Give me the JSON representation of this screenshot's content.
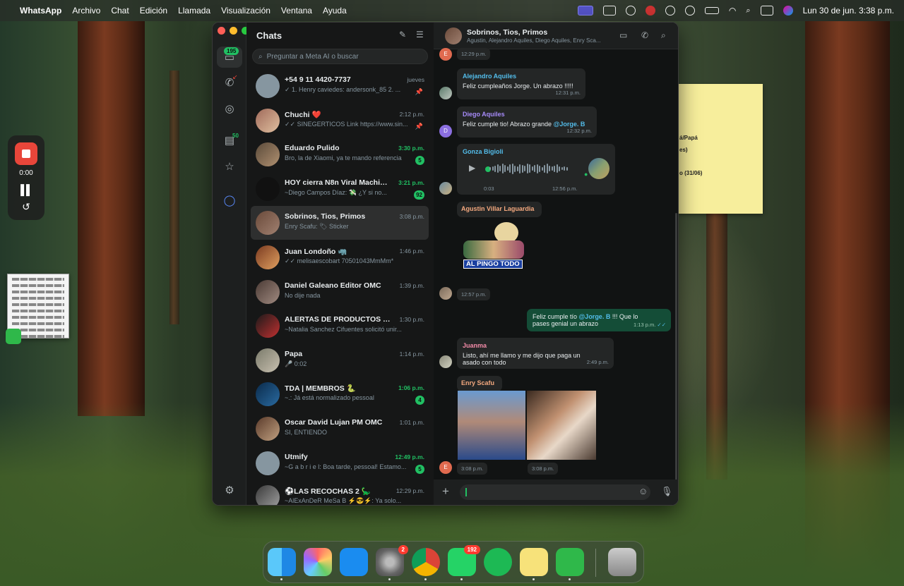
{
  "menubar": {
    "apple": "",
    "items": [
      "WhatsApp",
      "Archivo",
      "Chat",
      "Edición",
      "Llamada",
      "Visualización",
      "Ventana",
      "Ayuda"
    ],
    "clock": "Lun 30 de jun.  3:38 p.m."
  },
  "recorder": {
    "time": "0:00"
  },
  "sticky_note": {
    "lines": [
      "á/Papá",
      "es)",
      "o (31/06)"
    ]
  },
  "rail": {
    "chats_badge": "195",
    "status_badge": "50"
  },
  "list": {
    "title": "Chats",
    "search_placeholder": "Preguntar a Meta AI o buscar",
    "chats": [
      {
        "name": "+54 9 11 4420-7737",
        "time": "jueves",
        "preview": "✓ 1. Henry caviedes:  andersonk_85 2. ...",
        "pinned": true,
        "badge": "",
        "unread": false,
        "selected": false
      },
      {
        "name": "Chuchi ❤️",
        "time": "2:12 p.m.",
        "preview": "✓✓ SINEGERTICOS  Link  https://www.sin...",
        "pinned": true,
        "badge": "",
        "unread": false,
        "selected": false
      },
      {
        "name": "Eduardo Pulido",
        "time": "3:30 p.m.",
        "preview": "Bro, la de Xiaomi, ya te mando referencia",
        "pinned": false,
        "badge": "5",
        "unread": true,
        "selected": false
      },
      {
        "name": "HOY cierra N8n Viral Machine...",
        "time": "3:21 p.m.",
        "preview": "~Diego  Campos Díaz: 💸 ¿Y si no...",
        "pinned": false,
        "badge": "92",
        "unread": true,
        "selected": false
      },
      {
        "name": "Sobrinos, Tios, Primos",
        "time": "3:08 p.m.",
        "preview": "Enry Scafu: 🏷 Sticker",
        "pinned": false,
        "badge": "",
        "unread": false,
        "selected": true
      },
      {
        "name": "Juan Londoño 🦏",
        "time": "1:46 p.m.",
        "preview": "✓✓ melisaescobart  70501043MmMm*",
        "pinned": false,
        "badge": "",
        "unread": false,
        "selected": false
      },
      {
        "name": "Daniel Galeano Editor OMC",
        "time": "1:39 p.m.",
        "preview": "No dije nada",
        "pinned": false,
        "badge": "",
        "unread": false,
        "selected": false
      },
      {
        "name": "ALERTAS DE PRODUCTOS INT...",
        "time": "1:30 p.m.",
        "preview": "~Natalia Sanchez Cifuentes solicitó unir...",
        "pinned": false,
        "badge": "",
        "unread": false,
        "selected": false
      },
      {
        "name": "Papa",
        "time": "1:14 p.m.",
        "preview": "🎤 0:02",
        "pinned": false,
        "badge": "",
        "unread": false,
        "selected": false
      },
      {
        "name": "TDA | MEMBROS 🐍",
        "time": "1:06 p.m.",
        "preview": "~.: Já está normalizado pessoal",
        "pinned": false,
        "badge": "4",
        "unread": true,
        "selected": false
      },
      {
        "name": "Oscar David Lujan PM OMC",
        "time": "1:01 p.m.",
        "preview": "SI, ENTIENDO",
        "pinned": false,
        "badge": "",
        "unread": false,
        "selected": false
      },
      {
        "name": "Utmify",
        "time": "12:49 p.m.",
        "preview": "~G a b r i e l: Boa tarde, pessoal! Estamo...",
        "pinned": false,
        "badge": "5",
        "unread": true,
        "selected": false
      },
      {
        "name": "⚽LAS RECOCHAS 2 🦕",
        "time": "12:29 p.m.",
        "preview": "~AlExAnDeR MeSa B ⚡😎⚡: Ya solo...",
        "pinned": false,
        "badge": "",
        "unread": false,
        "selected": false
      }
    ]
  },
  "conversation": {
    "name": "Sobrinos, Tios, Primos",
    "members": "Agustin, Alejandro Aquiles, Diego Aquiles, Enry Sca...",
    "top_time": "12:29 p.m.",
    "top_avatar_letter": "E",
    "messages": {
      "alejandro": {
        "sender": "Alejandro Aquiles",
        "text": "Feliz cumpleaños Jorge. Un abrazo !!!!!",
        "time": "12:31 p.m.",
        "color": "#53bdeb"
      },
      "diego": {
        "sender": "Diego Aquiles",
        "text_before": "Feliz cumple tio! Abrazo grande ",
        "mention": "@Jorge. B",
        "time": "12:32 p.m.",
        "avatar_letter": "D",
        "color": "#a78bfa"
      },
      "gonza": {
        "sender": "Gonza Bigioli",
        "duration": "0:03",
        "time": "12:56 p.m.",
        "color": "#53bdeb"
      },
      "agustin": {
        "sender": "Agustin Villar Laguardia",
        "sticker_caption": "AL PINGO TODO",
        "time": "12:57 p.m.",
        "color": "#f5a97f"
      },
      "outgoing": {
        "text_before": "Feliz cumple tío ",
        "mention": "@Jorge. B",
        "text_after": " !!! Que lo pases genial un abrazo",
        "time": "1:13 p.m."
      },
      "juanma": {
        "sender": "Juanma",
        "text": "Listo, ahí me llamo y me dijo que paga un asado con todo",
        "time": "2:49 p.m.",
        "color": "#f38ba8"
      },
      "enry": {
        "sender": "Enry Scafu",
        "time1": "3:08 p.m.",
        "time2": "3:08 p.m.",
        "avatar_letter": "E",
        "color": "#f5a97f"
      }
    }
  },
  "dock": {
    "settings_badge": "2",
    "whatsapp_badge": "192"
  }
}
